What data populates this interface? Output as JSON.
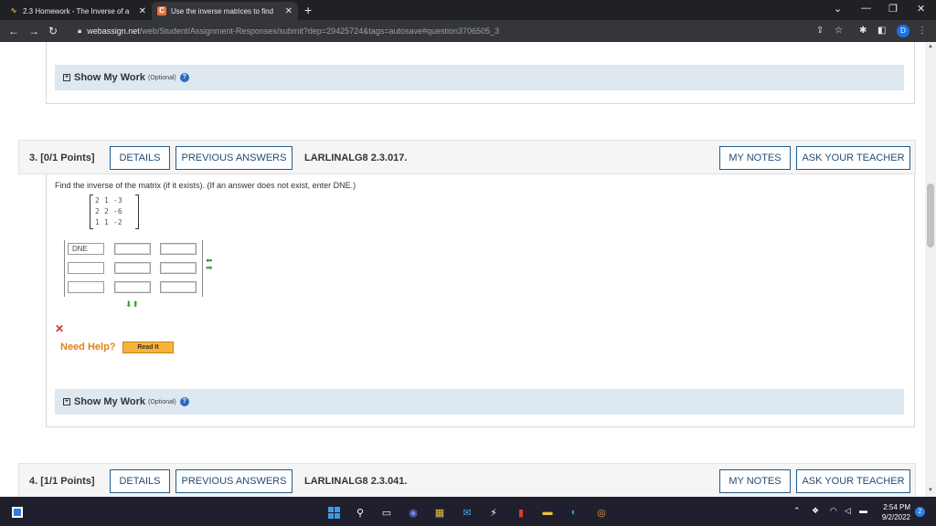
{
  "browser": {
    "tabs": [
      {
        "title": "2.3 Homework - The Inverse of a",
        "favicon": "calculus-icon",
        "active": false
      },
      {
        "title": "Use the inverse matrices to find",
        "favicon": "chegg-icon",
        "active": true
      }
    ],
    "url_host": "webassign.net",
    "url_path": "/web/Student/Assignment-Responses/submit?dep=29425724&tags=autosave#question3706505_3",
    "profile_initial": "D"
  },
  "page": {
    "show_my_work": {
      "label": "Show My Work",
      "optional": "(Optional)"
    },
    "question3": {
      "number": "3.",
      "points": "[0/1 Points]",
      "details": "DETAILS",
      "previous_answers": "PREVIOUS ANSWERS",
      "code": "LARLINALG8 2.3.017.",
      "my_notes": "MY NOTES",
      "ask_teacher": "ASK YOUR TEACHER",
      "prompt": "Find the inverse of the matrix (if it exists). (If an answer does not exist, enter DNE.)",
      "matrix": [
        [
          "2",
          "1",
          "-3"
        ],
        [
          "2",
          "2",
          "-6"
        ],
        [
          "1",
          "1",
          "-2"
        ]
      ],
      "answers": [
        "DNE",
        "",
        "",
        "",
        "",
        "",
        "",
        "",
        ""
      ],
      "need_help": "Need Help?",
      "read_it": "Read It"
    },
    "question4": {
      "number": "4.",
      "points": "[1/1 Points]",
      "details": "DETAILS",
      "previous_answers": "PREVIOUS ANSWERS",
      "code": "LARLINALG8 2.3.041.",
      "my_notes": "MY NOTES",
      "ask_teacher": "ASK YOUR TEACHER"
    }
  },
  "taskbar": {
    "time": "2:54 PM",
    "date": "9/2/2022",
    "notification_count": "2"
  }
}
